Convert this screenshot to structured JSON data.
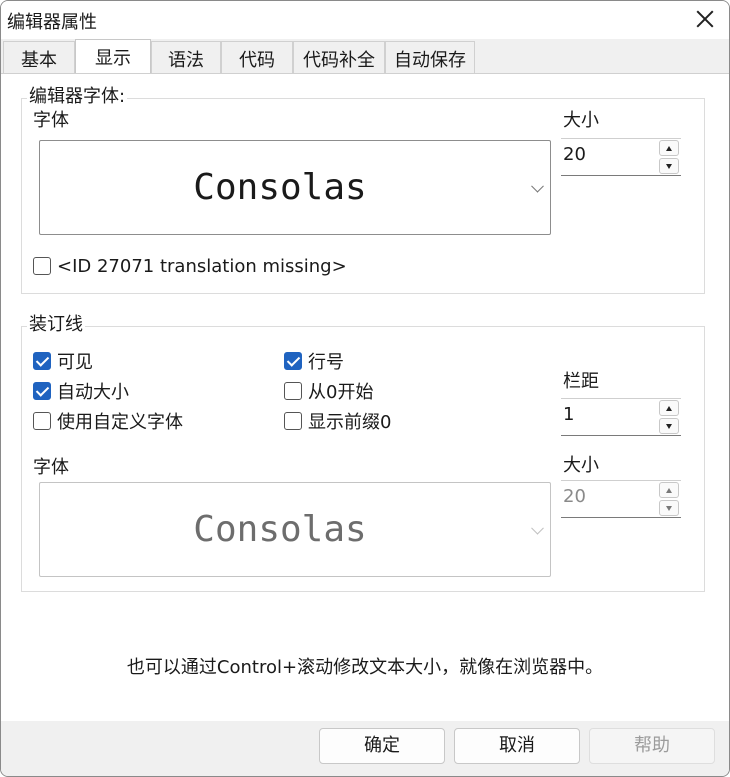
{
  "window": {
    "title": "编辑器属性"
  },
  "tabs": [
    {
      "label": "基本"
    },
    {
      "label": "显示"
    },
    {
      "label": "语法"
    },
    {
      "label": "代码"
    },
    {
      "label": "代码补全"
    },
    {
      "label": "自动保存"
    }
  ],
  "active_tab": "显示",
  "editor_font": {
    "group_label": "编辑器字体:",
    "font_label": "字体",
    "font_value": "Consolas",
    "size_label": "大小",
    "size_value": "20",
    "checkbox_label": "<ID 27071 translation missing>",
    "checkbox_checked": false
  },
  "gutter": {
    "group_label": "装订线",
    "visible": {
      "label": "可见",
      "checked": true
    },
    "auto_size": {
      "label": "自动大小",
      "checked": true
    },
    "custom_font": {
      "label": "使用自定义字体",
      "checked": false
    },
    "line_numbers": {
      "label": "行号",
      "checked": true
    },
    "start_zero": {
      "label": "从0开始",
      "checked": false
    },
    "leading_zero": {
      "label": "显示前缀0",
      "checked": false
    },
    "spacing_label": "栏距",
    "spacing_value": "1",
    "font_label": "字体",
    "font_value": "Consolas",
    "size_label": "大小",
    "size_value": "20"
  },
  "hint": "也可以通过Control+滚动修改文本大小，就像在浏览器中。",
  "buttons": {
    "ok": "确定",
    "cancel": "取消",
    "help": "帮助"
  },
  "colors": {
    "checkbox_accent": "#1f63c0"
  }
}
